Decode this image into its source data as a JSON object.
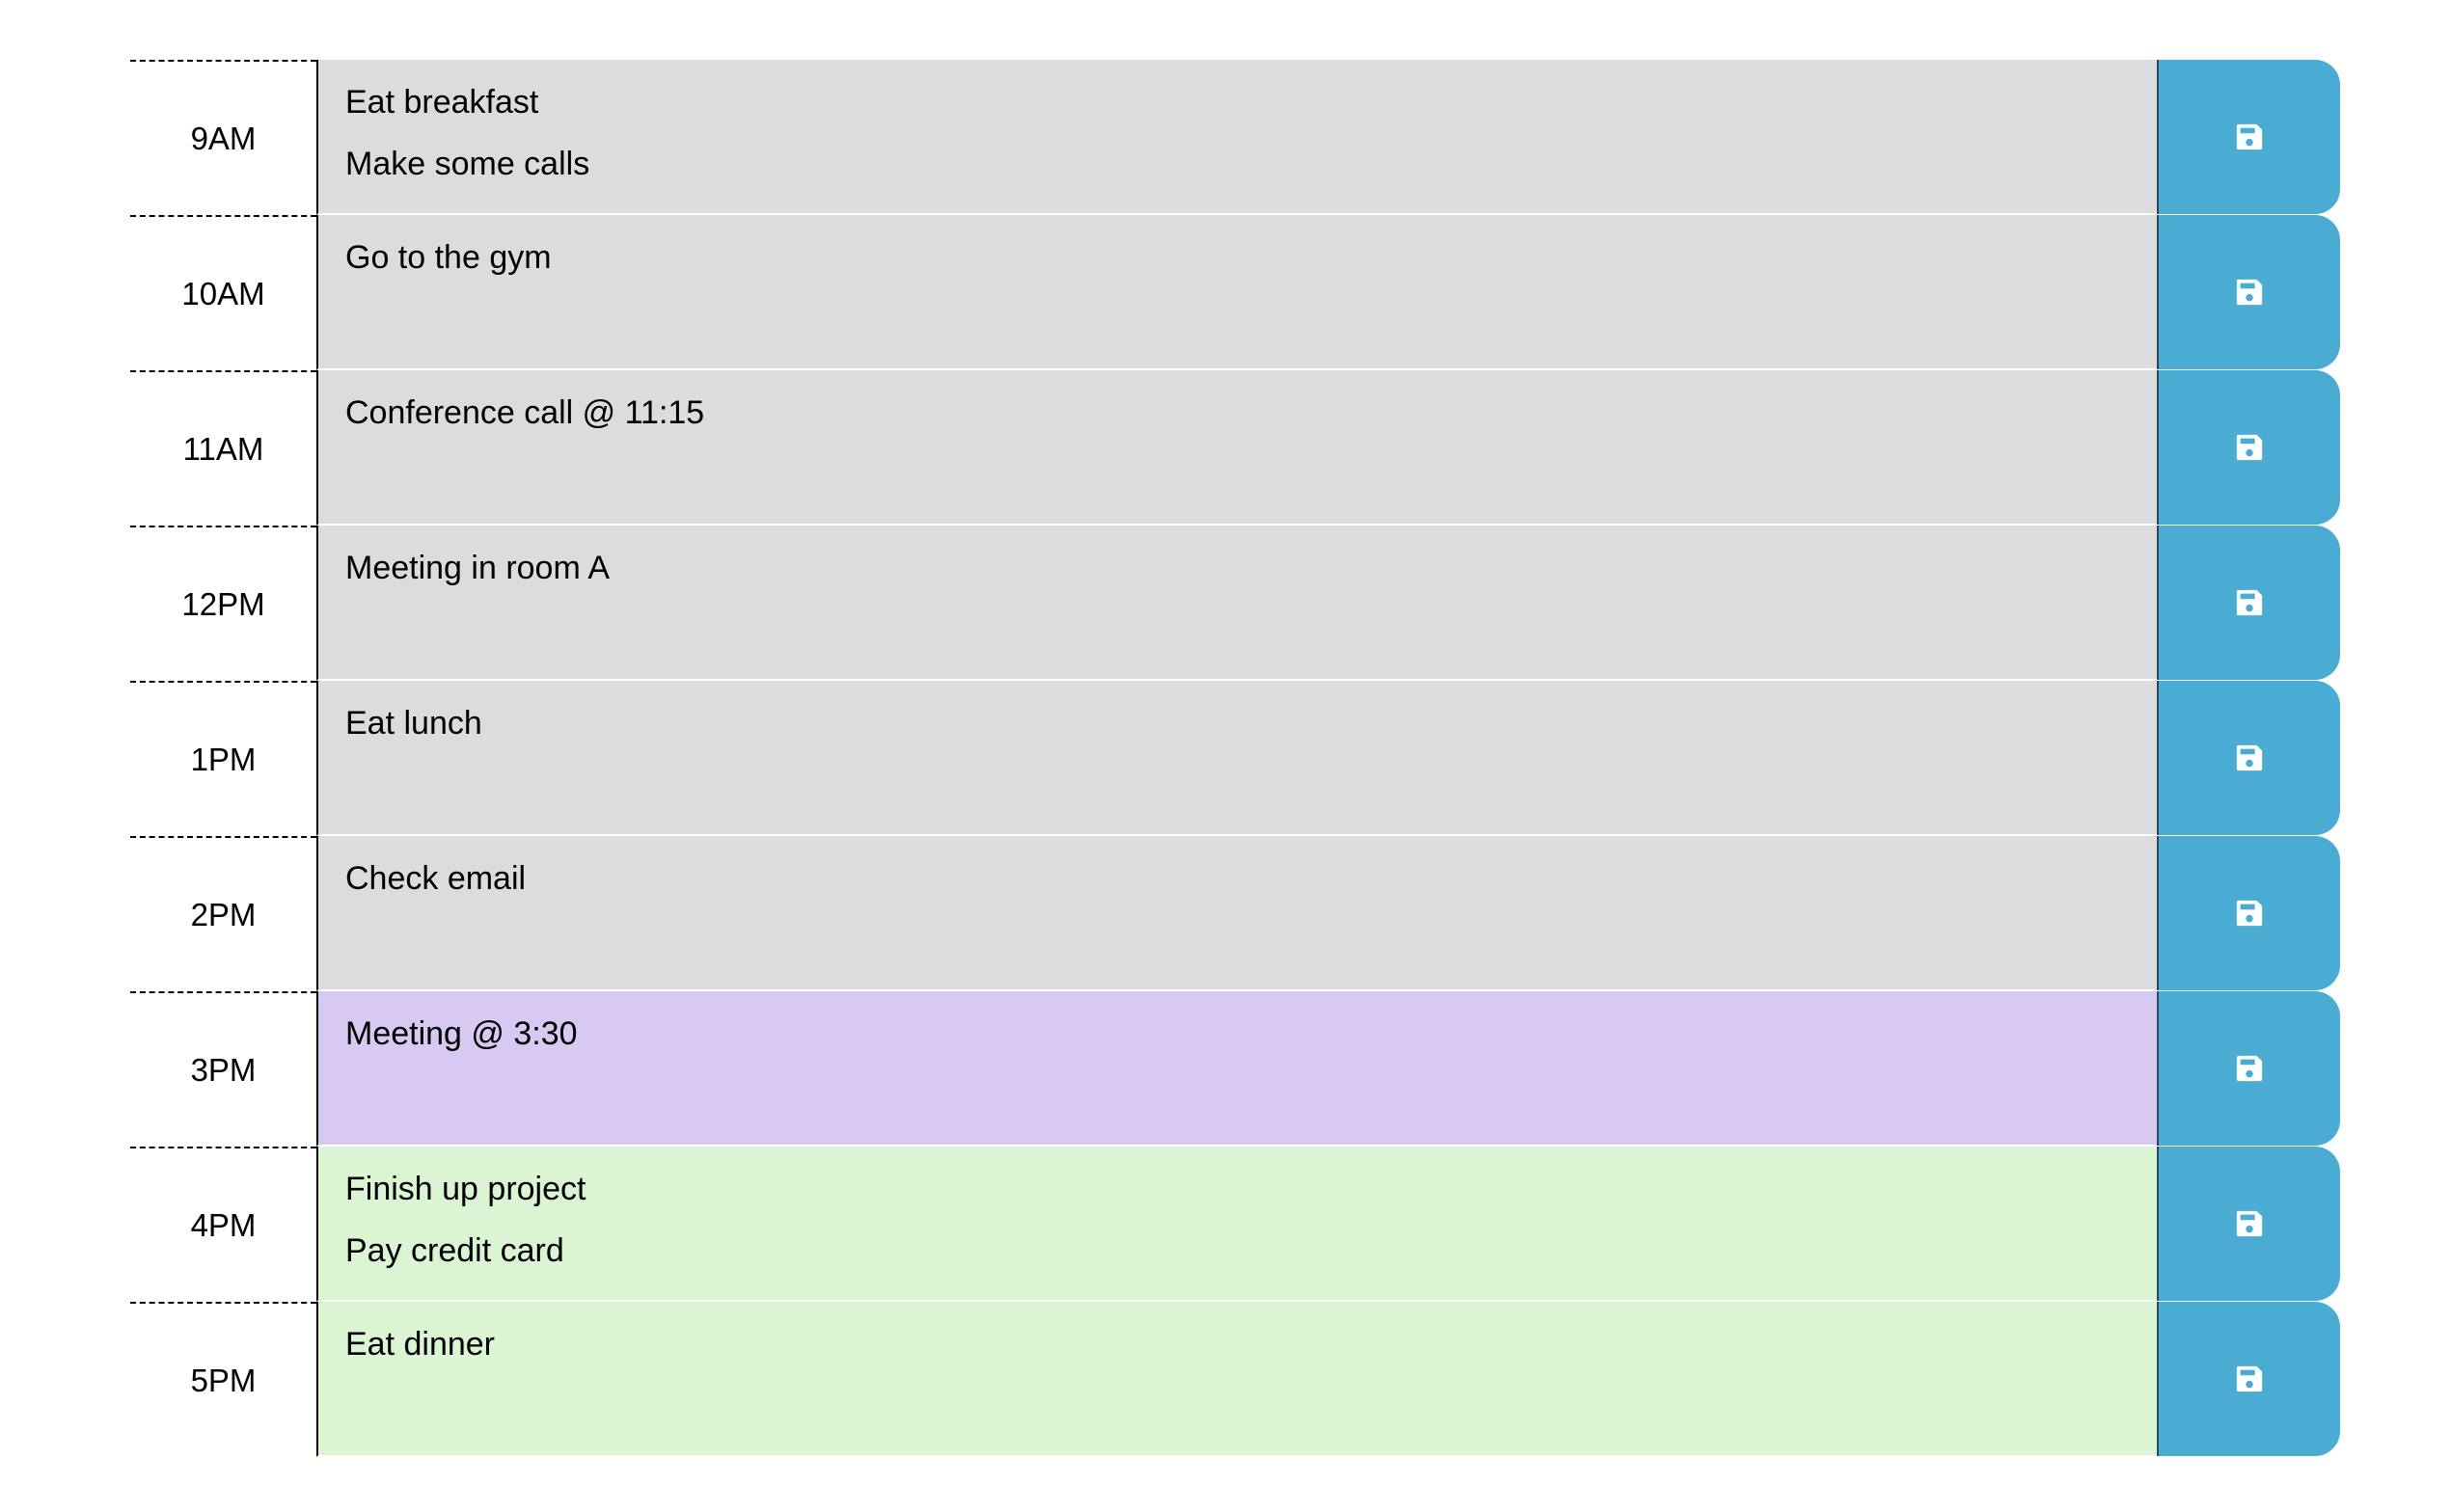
{
  "colors": {
    "past": "#dcdcde",
    "present": "#d8c9f3",
    "future": "#dbf4d4",
    "save_button": "#4aabd3"
  },
  "rows": [
    {
      "hour": "9AM",
      "text": "Eat breakfast\nMake some calls",
      "state": "past",
      "save_icon": "floppy-disk-icon"
    },
    {
      "hour": "10AM",
      "text": "Go to the gym",
      "state": "past",
      "save_icon": "floppy-disk-icon"
    },
    {
      "hour": "11AM",
      "text": "Conference call @ 11:15",
      "state": "past",
      "save_icon": "floppy-disk-icon"
    },
    {
      "hour": "12PM",
      "text": "Meeting in room A",
      "state": "past",
      "save_icon": "floppy-disk-icon"
    },
    {
      "hour": "1PM",
      "text": "Eat lunch",
      "state": "past",
      "save_icon": "floppy-disk-icon"
    },
    {
      "hour": "2PM",
      "text": "Check email",
      "state": "past",
      "save_icon": "floppy-disk-icon"
    },
    {
      "hour": "3PM",
      "text": "Meeting @ 3:30",
      "state": "present",
      "save_icon": "floppy-disk-icon"
    },
    {
      "hour": "4PM",
      "text": "Finish up project\nPay credit card",
      "state": "future",
      "save_icon": "floppy-disk-icon"
    },
    {
      "hour": "5PM",
      "text": "Eat dinner",
      "state": "future",
      "save_icon": "floppy-disk-icon"
    }
  ]
}
